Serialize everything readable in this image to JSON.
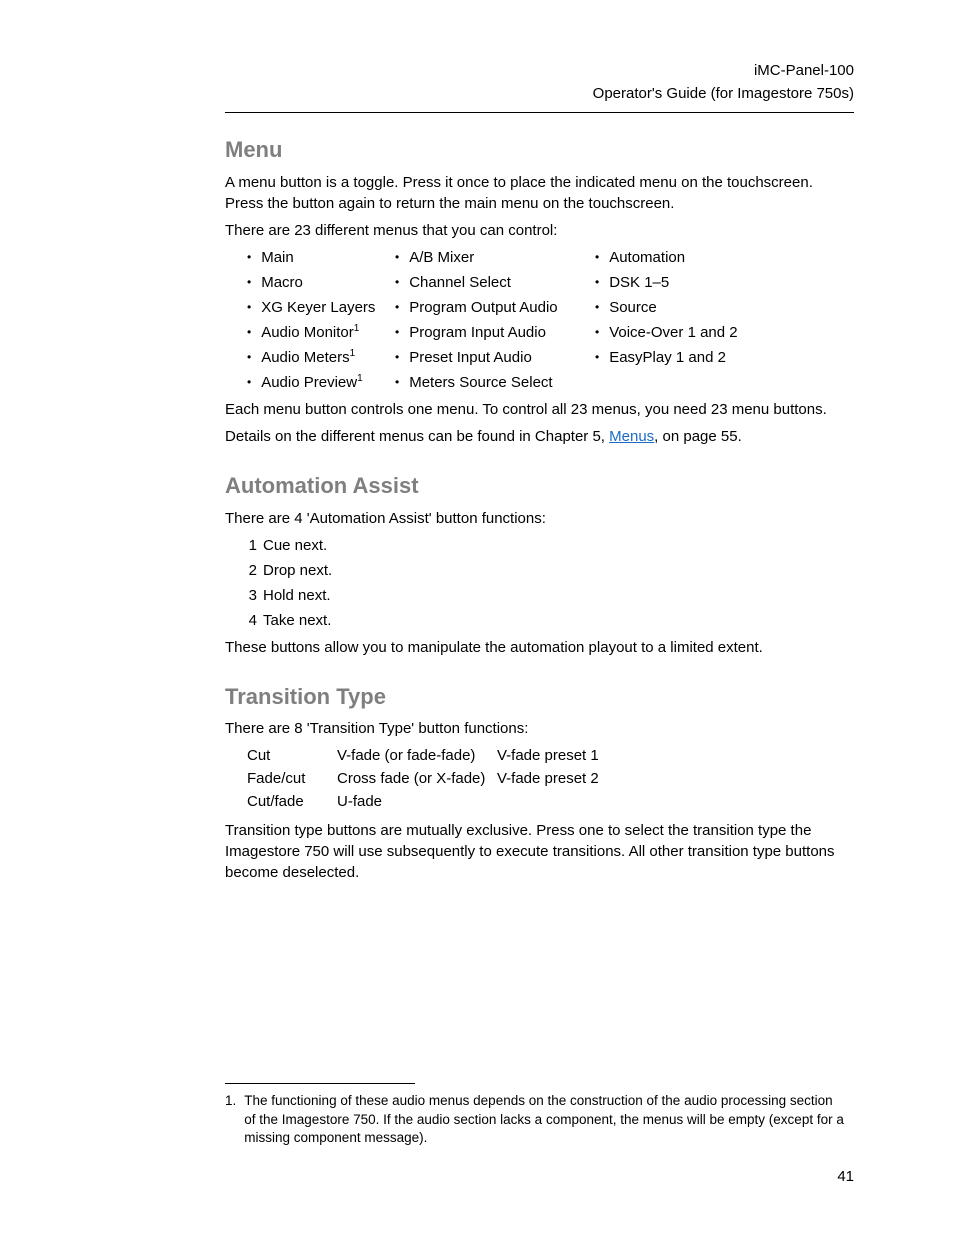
{
  "header": {
    "title": "iMC-Panel-100",
    "subtitle": "Operator's Guide (for Imagestore 750s)"
  },
  "menu": {
    "title": "Menu",
    "p1": "A menu button is a toggle. Press it once to place the indicated menu on the touchscreen. Press the button again to return the main menu on the touchscreen.",
    "p2": "There are 23 different menus that you can control:",
    "col1": [
      {
        "label": "Main",
        "sup": ""
      },
      {
        "label": "Macro",
        "sup": ""
      },
      {
        "label": "XG Keyer Layers",
        "sup": ""
      },
      {
        "label": "Audio Monitor",
        "sup": "1"
      },
      {
        "label": "Audio Meters",
        "sup": "1"
      },
      {
        "label": "Audio Preview",
        "sup": "1"
      }
    ],
    "col2": [
      {
        "label": "A/B Mixer",
        "bullet": true
      },
      {
        "label": "Channel Select",
        "bullet": true
      },
      {
        "label": "Program Output Audio",
        "bullet": true
      },
      {
        "label": "Program Input Audio",
        "bullet": true
      },
      {
        "label": "Preset Input Audio",
        "bullet": true
      },
      {
        "label": "Meters Source Select",
        "bullet": false
      }
    ],
    "col3": [
      {
        "label": "Automation"
      },
      {
        "label": "DSK 1–5"
      },
      {
        "label": "Source"
      },
      {
        "label": "Voice-Over 1 and 2"
      },
      {
        "label": "EasyPlay 1 and 2"
      }
    ],
    "p3": "Each menu button controls one menu. To control all 23 menus, you need 23 menu buttons.",
    "p4_pre": "Details on the different menus can be found in Chapter 5, ",
    "p4_link": "Menus",
    "p4_post": ", on page 55."
  },
  "automation": {
    "title": "Automation Assist",
    "p1": "There are 4 'Automation Assist' button functions:",
    "items": [
      "Cue next.",
      "Drop next.",
      "Hold next.",
      "Take next."
    ],
    "p2": "These buttons allow you to manipulate the automation playout to a limited extent."
  },
  "transition": {
    "title": "Transition Type",
    "p1": "There are 8 'Transition Type' button functions:",
    "rows": [
      {
        "c1": "Cut",
        "c2": "V-fade (or fade-fade)",
        "c3": "V-fade preset 1"
      },
      {
        "c1": "Fade/cut",
        "c2": "Cross fade (or X-fade)",
        "c3": "V-fade preset 2"
      },
      {
        "c1": "Cut/fade",
        "c2": "U-fade",
        "c3": ""
      }
    ],
    "p2": "Transition type buttons are mutually exclusive. Press one to select the transition type the Imagestore 750 will use subsequently to execute transitions. All other transition type buttons become deselected."
  },
  "footnote": {
    "num": "1.",
    "text": "The functioning of these audio menus depends on the construction of the audio processing section of the Imagestore 750. If the audio section lacks a component, the menus will be empty (except for a missing component message)."
  },
  "pageNumber": "41"
}
